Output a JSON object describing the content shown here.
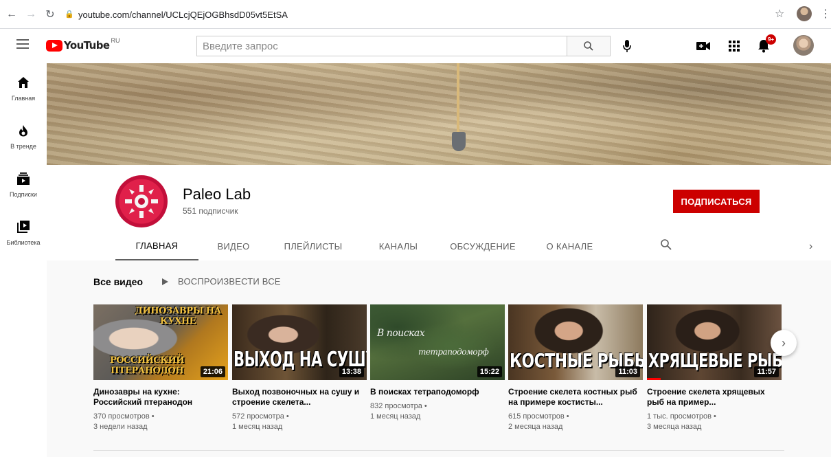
{
  "browser": {
    "url": "youtube.com/channel/UCLcjQEjOGBhsdD05vt5EtSA"
  },
  "header": {
    "logo_text": "YouTube",
    "logo_region": "RU",
    "search_placeholder": "Введите запрос",
    "notifications_badge": "9+"
  },
  "guide": {
    "items": [
      {
        "label": "Главная",
        "icon": "home-icon"
      },
      {
        "label": "В тренде",
        "icon": "fire-icon"
      },
      {
        "label": "Подписки",
        "icon": "subscriptions-icon"
      },
      {
        "label": "Библиотека",
        "icon": "library-icon"
      }
    ]
  },
  "channel": {
    "name": "Paleo Lab",
    "subscribers": "551 подписчик",
    "subscribe_label": "ПОДПИСАТЬСЯ",
    "tabs": [
      {
        "label": "ГЛАВНАЯ",
        "active": true
      },
      {
        "label": "ВИДЕО",
        "active": false
      },
      {
        "label": "ПЛЕЙЛИСТЫ",
        "active": false
      },
      {
        "label": "КАНАЛЫ",
        "active": false
      },
      {
        "label": "ОБСУЖДЕНИЕ",
        "active": false
      },
      {
        "label": "О КАНАЛЕ",
        "active": false
      }
    ]
  },
  "shelf": {
    "title": "Все видео",
    "play_all": "ВОСПРОИЗВЕСТИ ВСЕ",
    "videos": [
      {
        "thumb_top": "ДИНОЗАВРЫ НА КУХНЕ",
        "thumb_bottom": "РОССИЙСКИЙ ПТЕРАНОДОН",
        "duration": "21:06",
        "title": "Динозавры на кухне: Российский птеранодон",
        "views": "370 просмотров •",
        "age": "3 недели назад"
      },
      {
        "thumb_text": "ВЫХОД НА СУШУ",
        "duration": "13:38",
        "title": "Выход позвоночных на сушу и строение скелета...",
        "views": "572 просмотра •",
        "age": "1 месяц назад"
      },
      {
        "thumb_script1": "В поисках",
        "thumb_script2": "тетраподоморф",
        "duration": "15:22",
        "title": "В поисках тетраподоморф",
        "views": "832 просмотра •",
        "age": "1 месяц назад"
      },
      {
        "thumb_text": "КОСТНЫЕ РЫБЫ",
        "duration": "11:03",
        "title": "Строение скелета костных рыб на примере костисты...",
        "views": "615 просмотров •",
        "age": "2 месяца назад"
      },
      {
        "thumb_text": "ХРЯЩЕВЫЕ РЫБЫ",
        "duration": "11:57",
        "title": "Строение скелета хрящевых рыб на пример...",
        "views": "1 тыс. просмотров •",
        "age": "3 месяца назад",
        "watched_fraction": 0.1
      }
    ]
  }
}
